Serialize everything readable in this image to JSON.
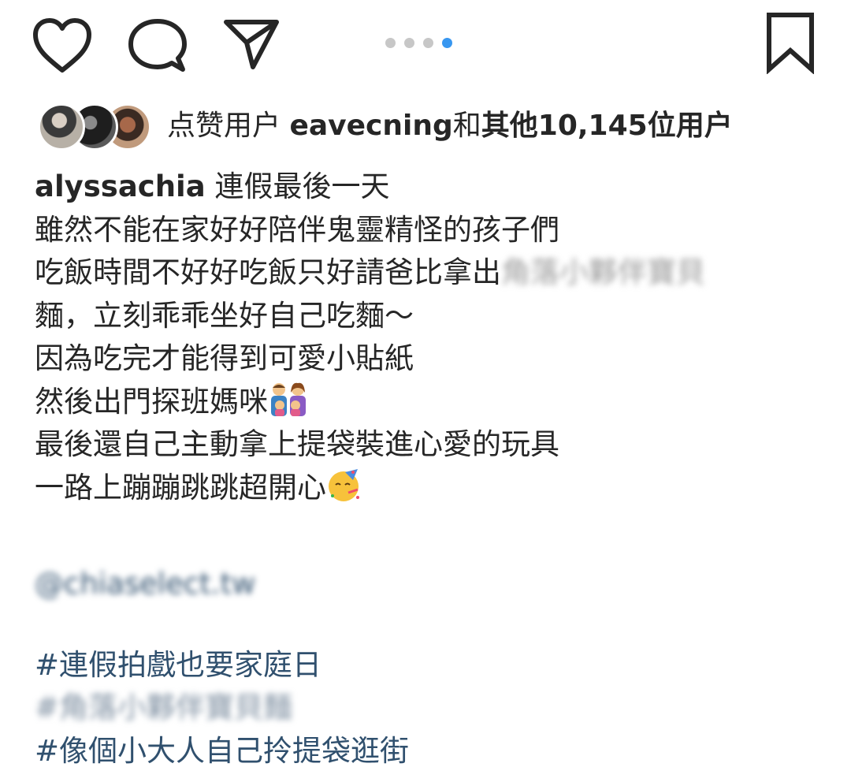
{
  "actions": {
    "like_icon": "heart-outline-icon",
    "comment_icon": "speech-bubble-icon",
    "share_icon": "paper-plane-icon",
    "save_icon": "bookmark-icon",
    "carousel": {
      "total": 4,
      "active_index": 3,
      "active_color": "#3897f0",
      "inactive_color": "#c7c7c7"
    }
  },
  "likes": {
    "prefix": "点赞用户 ",
    "user": "eavecning",
    "and": "和",
    "others": "其他10,145位用户"
  },
  "caption": {
    "username": "alyssachia",
    "first_line": " 連假最後一天",
    "lines": [
      "雖然不能在家好好陪伴鬼靈精怪的孩子們",
      "吃飯時間不好好吃飯只好請爸比拿出",
      "麵，立刻乖乖坐好自己吃麵～",
      "因為吃完才能得到可愛小貼紙",
      "然後出門探班媽咪",
      "最後還自己主動拿上提袋裝進心愛的玩具",
      "一路上蹦蹦跳跳超開心"
    ],
    "blurred_product": "角落小夥伴寶貝",
    "mention": "@chiaselect.tw",
    "hashtags": [
      "#連假拍戲也要家庭日",
      "#角落小夥伴寶貝麵",
      "#像個小大人自己拎提袋逛街"
    ],
    "emoji_family": "family-emoji",
    "emoji_party": "party-face-emoji"
  }
}
